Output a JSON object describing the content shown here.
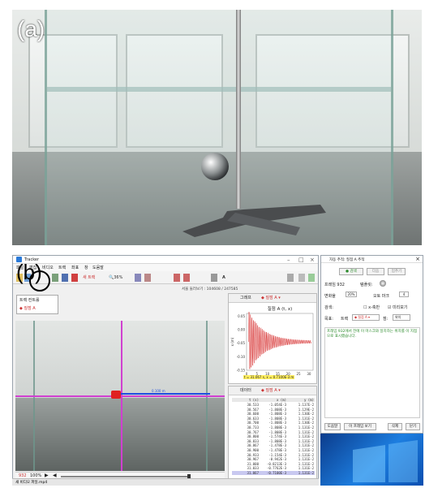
{
  "panel_a": {
    "label": "(a)"
  },
  "panel_b": {
    "label": "(b)"
  },
  "app": {
    "title": "Tracker",
    "menu": [
      "파일",
      "편집",
      "비디오",
      "트랙",
      "좌표",
      "창",
      "도움말"
    ],
    "toolbar": {
      "new_track": "새 트랙",
      "zoom": "36%",
      "auto_label": "A"
    },
    "info_line": "서울 둘러보기 : 104608 / 247585",
    "tracks_popup": {
      "title": "트랙 컨트롤",
      "item": "질점 A"
    },
    "scale_label": "0.100 m",
    "graph": {
      "tab": "그래프",
      "track": "질점 A",
      "title": "질점 A (t, x)",
      "ylabel": "x (m)",
      "readout": "t = 31.067 s, x = 0.7100E-3 m"
    },
    "table": {
      "tab": "데이터",
      "track": "질점 A",
      "headers": [
        "t (s)",
        "x (m)",
        "y (m)"
      ],
      "rows": [
        [
          "30.533",
          "-1.054E-3",
          "1.137E-2"
        ],
        [
          "30.567",
          "-1.808E-3",
          "1.129E-2"
        ],
        [
          "30.600",
          "-1.808E-3",
          "1.130E-2"
        ],
        [
          "30.633",
          "-1.808E-3",
          "1.131E-2"
        ],
        [
          "30.700",
          "-1.808E-3",
          "1.130E-2"
        ],
        [
          "30.733",
          "-1.808E-3",
          "1.131E-2"
        ],
        [
          "30.767",
          "-1.808E-3",
          "1.131E-2"
        ],
        [
          "30.800",
          "-1.574E-3",
          "1.131E-2"
        ],
        [
          "30.833",
          "-1.808E-3",
          "1.131E-2"
        ],
        [
          "30.867",
          "-1.478E-3",
          "1.131E-2"
        ],
        [
          "30.900",
          "-1.478E-3",
          "1.131E-2"
        ],
        [
          "30.933",
          "-1.154E-3",
          "1.131E-2"
        ],
        [
          "30.967",
          "-0.942E-3",
          "1.131E-2"
        ],
        [
          "31.000",
          "-0.8213E-3",
          "1.131E-2"
        ],
        [
          "31.033",
          "-0.7762E-3",
          "1.131E-2"
        ],
        [
          "31.067",
          "-0.7100E-3",
          "1.131E-2"
        ]
      ]
    },
    "player": {
      "frame": "932",
      "zoom": "100%"
    },
    "file_tab": "새 비디오 파일.mp4"
  },
  "dialog": {
    "title": "자동 추적: 질점 A 추적",
    "search_btn": "검색",
    "next_btn": "다음",
    "stop_btn": "멈추기",
    "frame_label": "프레임 932",
    "template_label": "템플릿:",
    "evolve_label": "변화율",
    "evolve_value": "20%",
    "tether_label": "오토 마크",
    "tether_value": "4",
    "search_label": "검색:",
    "xaxis_label": "x-축만",
    "look_ahead": "미리보기",
    "target_label": "목표:",
    "target_track": "트랙",
    "target_point": "질점 A",
    "target_pos_label": "점:",
    "target_pos": "위치",
    "message": "프레임 932에서 전에 이 마스크와 일치하는 위치를 이 지점으로 표시했습니다.",
    "buttons": [
      "도움말",
      "이 프레임 보기",
      "삭제",
      "닫기"
    ]
  },
  "chart_data": {
    "type": "line",
    "title": "질점 A (t, x)",
    "xlabel": "t (s)",
    "ylabel": "x (m)",
    "xlim": [
      0,
      32
    ],
    "ylim": [
      -0.15,
      0.06
    ],
    "xticks": [
      0,
      5,
      10,
      15,
      20,
      25,
      30
    ],
    "yticks": [
      0.05,
      0,
      -0.05,
      -0.1,
      -0.15
    ],
    "series": [
      {
        "decay_start": 0.11,
        "period_s": 0.7,
        "t0": 1.0,
        "t_end": 31.1
      }
    ]
  }
}
